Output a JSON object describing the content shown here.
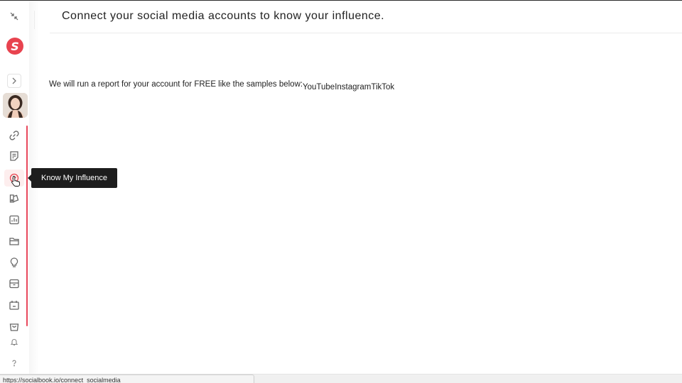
{
  "header": {
    "title": "Connect your social media accounts to know your influence."
  },
  "intro": {
    "text": "We will run a report for your account for FREE like the samples below:"
  },
  "platforms": [
    "YouTube",
    "Instagram",
    "TikTok"
  ],
  "sidebar": {
    "logo_letter": "S",
    "items": [
      {
        "icon": "link-icon"
      },
      {
        "icon": "document-icon"
      },
      {
        "icon": "influence-icon",
        "active": true
      },
      {
        "icon": "brand-icon"
      },
      {
        "icon": "analytics-icon"
      },
      {
        "icon": "folder-icon"
      },
      {
        "icon": "lightbulb-icon"
      },
      {
        "icon": "archive-icon"
      },
      {
        "icon": "calendar-box-icon"
      },
      {
        "icon": "shopping-bag-icon"
      },
      {
        "icon": "bell-icon"
      },
      {
        "icon": "help-icon"
      }
    ]
  },
  "tooltip": {
    "text": "Know My Influence"
  },
  "status_bar": {
    "url": "https://socialbook.io/connect_socialmedia"
  },
  "colors": {
    "accent": "#e8434f",
    "tooltip_bg": "#1d1d1d",
    "scroll_indicator": "#e8485c"
  }
}
